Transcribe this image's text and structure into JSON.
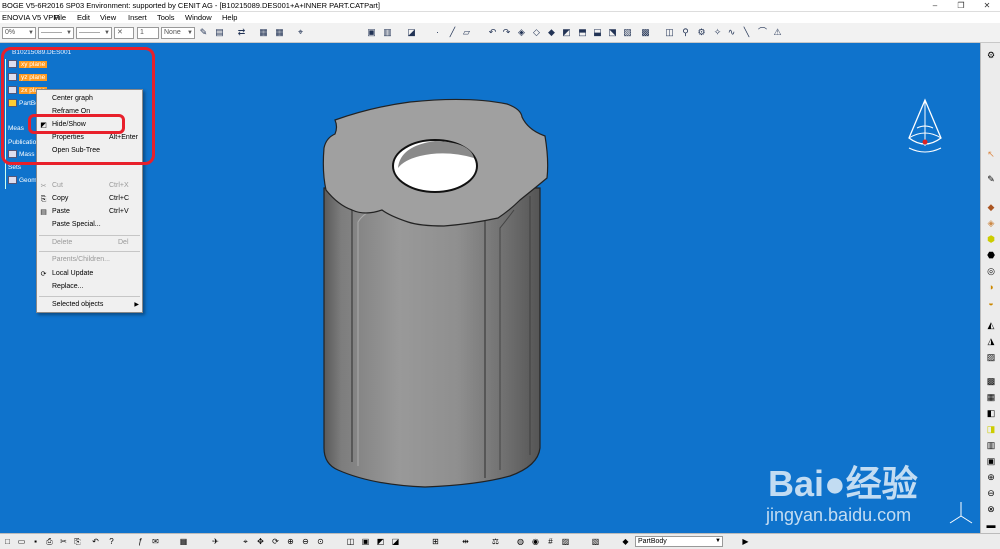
{
  "window": {
    "title": "BOGE V5-6R2016 SP03 Environment: supported by CENIT AG - [B10215089.DES001+A+INNER PART.CATPart]",
    "minimize": "–",
    "restore": "❐",
    "close": "✕"
  },
  "menubar": [
    "ENOVIA V5 VPM",
    "File",
    "Edit",
    "View",
    "Insert",
    "Tools",
    "Window",
    "Help"
  ],
  "toolbar": {
    "transparency": "0%",
    "line_type": "———",
    "line_weight": "———",
    "point_symbol": "✕",
    "layer_num": "1",
    "layer": "None"
  },
  "tree": {
    "root": "B10215089.DES001",
    "nodes": [
      {
        "label": "xy plane",
        "highlighted": true
      },
      {
        "label": "yz plane",
        "highlighted": true
      },
      {
        "label": "zx plane",
        "highlighted": true
      },
      {
        "label": "PartBody",
        "highlighted": false
      },
      {
        "label": "Meas",
        "highlighted": false
      },
      {
        "label": "Publication",
        "highlighted": false
      },
      {
        "label": "Mass",
        "highlighted": false
      },
      {
        "label": "Sets",
        "highlighted": false
      },
      {
        "label": "Geom",
        "highlighted": false
      }
    ]
  },
  "context_menu": {
    "items": [
      {
        "label": "Center graph",
        "shortcut": "",
        "disabled": false,
        "icon": ""
      },
      {
        "label": "Reframe On",
        "shortcut": "",
        "disabled": false,
        "icon": ""
      },
      {
        "label": "Hide/Show",
        "shortcut": "",
        "disabled": false,
        "icon": "hide-show"
      },
      {
        "label": "Properties",
        "shortcut": "Alt+Enter",
        "disabled": false,
        "icon": ""
      },
      {
        "label": "Open Sub-Tree",
        "shortcut": "",
        "disabled": false,
        "icon": ""
      },
      {
        "label": "Cut",
        "shortcut": "Ctrl+X",
        "disabled": true,
        "icon": "cut"
      },
      {
        "label": "Copy",
        "shortcut": "Ctrl+C",
        "disabled": false,
        "icon": "copy"
      },
      {
        "label": "Paste",
        "shortcut": "Ctrl+V",
        "disabled": false,
        "icon": "paste"
      },
      {
        "label": "Paste Special...",
        "shortcut": "",
        "disabled": false,
        "icon": ""
      },
      {
        "label": "Delete",
        "shortcut": "Del",
        "disabled": true,
        "icon": ""
      },
      {
        "label": "Parents/Children...",
        "shortcut": "",
        "disabled": true,
        "icon": ""
      },
      {
        "label": "Local Update",
        "shortcut": "",
        "disabled": false,
        "icon": "update"
      },
      {
        "label": "Replace...",
        "shortcut": "",
        "disabled": false,
        "icon": ""
      },
      {
        "label": "Selected objects",
        "shortcut": "",
        "disabled": false,
        "icon": "",
        "submenu": true
      }
    ]
  },
  "bottom_toolbar": {
    "body_combo": "PartBody"
  },
  "watermark": {
    "brand": "Bai●经验",
    "url": "jingyan.baidu.com"
  },
  "colors": {
    "viewport_bg": "#0f73cc",
    "highlight": "#ff9a1f",
    "annotation_red": "#e8202b"
  }
}
